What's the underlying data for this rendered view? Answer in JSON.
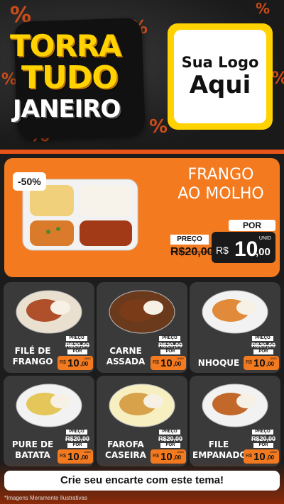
{
  "header": {
    "title_line1": "TORRA",
    "title_line2": "TUDO",
    "title_line3": "JANEIRO",
    "logo_line1": "Sua Logo",
    "logo_line2": "Aqui",
    "percent_symbol": "%"
  },
  "hero": {
    "discount": "-50%",
    "title_line1": "FRANGO",
    "title_line2": "AO MOLHO",
    "por_label": "POR",
    "preco_label": "PREÇO",
    "old_price": "R$20,00",
    "currency": "R$",
    "price_int": "10",
    "price_dec": ",00",
    "unit": "UNID"
  },
  "products": [
    {
      "line1": "FILÉ DE",
      "line2": "FRANGO",
      "preco_label": "PREÇO",
      "old_price": "R$20,00",
      "por_label": "POR",
      "currency": "R$",
      "price_int": "10",
      "price_dec": ",00",
      "unit": "UNID"
    },
    {
      "line1": "CARNE",
      "line2": "ASSADA",
      "preco_label": "PREÇO",
      "old_price": "R$20,00",
      "por_label": "POR",
      "currency": "R$",
      "price_int": "10",
      "price_dec": ",00",
      "unit": "UNID"
    },
    {
      "line1": "NHOQUE",
      "line2": "",
      "preco_label": "PREÇO",
      "old_price": "R$20,00",
      "por_label": "POR",
      "currency": "R$",
      "price_int": "10",
      "price_dec": ",00",
      "unit": "UNID"
    },
    {
      "line1": "PURE DE",
      "line2": "BATATA",
      "preco_label": "PREÇO",
      "old_price": "R$20,00",
      "por_label": "POR",
      "currency": "R$",
      "price_int": "10",
      "price_dec": ",00",
      "unit": "UNID"
    },
    {
      "line1": "FAROFA",
      "line2": "CASEIRA",
      "preco_label": "PREÇO",
      "old_price": "R$20,00",
      "por_label": "POR",
      "currency": "R$",
      "price_int": "10",
      "price_dec": ",00",
      "unit": "UNID"
    },
    {
      "line1": "FILE",
      "line2": "EMPANADO",
      "preco_label": "PREÇO",
      "old_price": "R$20,00",
      "por_label": "POR",
      "currency": "R$",
      "price_int": "10",
      "price_dec": ",00",
      "unit": "UNID"
    }
  ],
  "footer": {
    "cta": "Crie seu encarte com este tema!",
    "note": "*Imagens Meramente Ilustrativas"
  },
  "colors": {
    "accent": "#f47a20",
    "title_yellow": "#ffd200",
    "dark": "#1a1a1a",
    "card": "#3a3a3a"
  }
}
